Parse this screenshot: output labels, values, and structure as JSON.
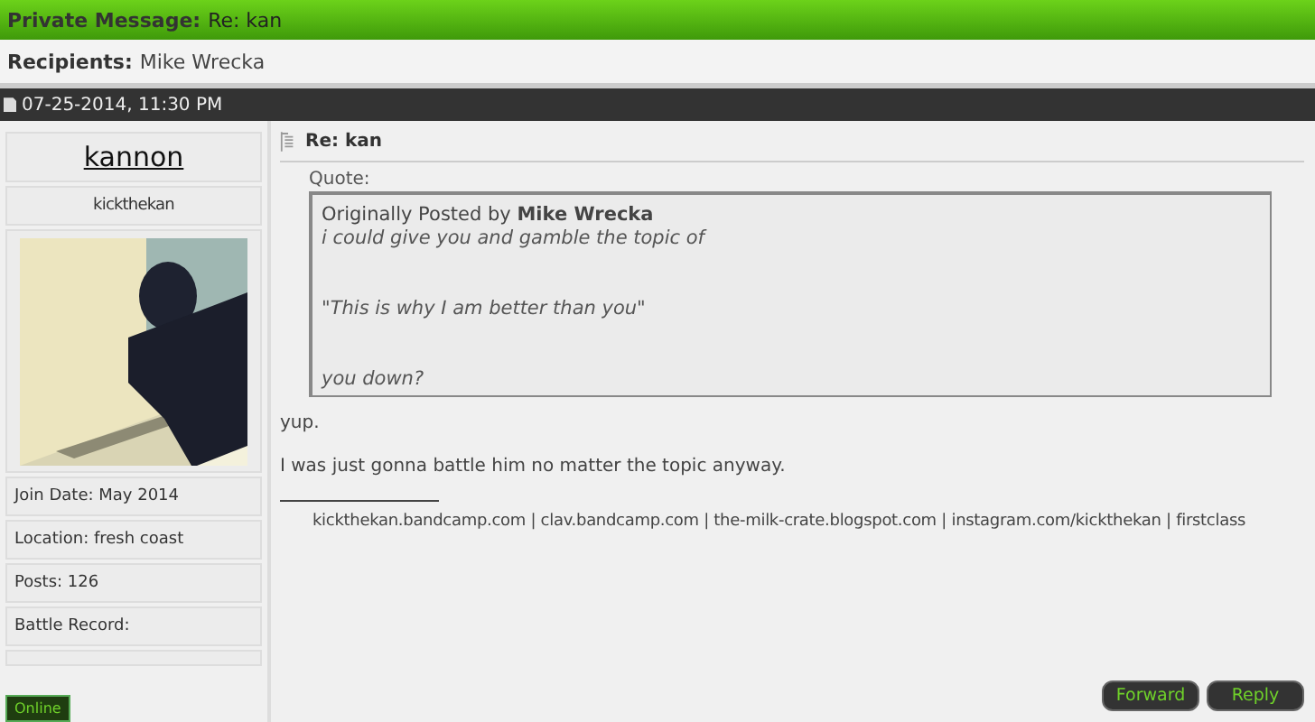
{
  "header": {
    "label": "Private Message:",
    "title": "Re: kan"
  },
  "recipients": {
    "label": "Recipients:",
    "value": "Mike Wrecka"
  },
  "post_date": "07-25-2014, 11:30 PM",
  "user": {
    "name": "kannon",
    "title": "kickthekan",
    "fields": [
      "Join Date: May 2014",
      "Location: fresh coast",
      "Posts: 126",
      "Battle Record:"
    ],
    "online": true,
    "status": "Online"
  },
  "post": {
    "title": "Re: kan",
    "quote": {
      "label": "Quote:",
      "intro": "Originally Posted by",
      "author": "Mike Wrecka",
      "lines": [
        "i could give you and gamble the topic of",
        "\"This is why I am better than you\"",
        "you down?"
      ]
    },
    "body": [
      "yup.",
      "I was just gonna battle him no matter the topic anyway."
    ],
    "signature": "kickthekan.bandcamp.com | clav.bandcamp.com | the-milk-crate.blogspot.com | instagram.com/kickthekan | firstclass"
  },
  "buttons": [
    "Forward",
    "Reply"
  ]
}
